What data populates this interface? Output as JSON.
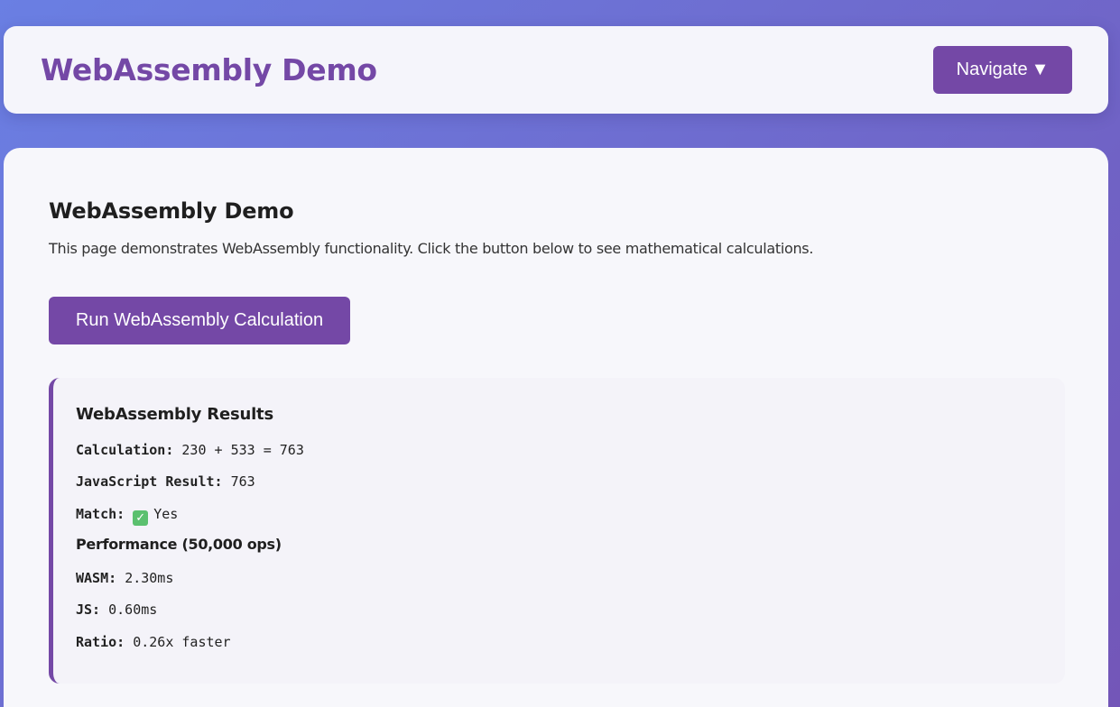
{
  "header": {
    "title": "WebAssembly Demo",
    "nav_label": "Navigate",
    "nav_caret": "▼"
  },
  "main": {
    "heading": "WebAssembly Demo",
    "description": "This page demonstrates WebAssembly functionality. Click the button below to see mathematical calculations.",
    "run_button_label": "Run WebAssembly Calculation"
  },
  "results": {
    "title": "WebAssembly Results",
    "calculation": {
      "label": "Calculation:",
      "value": "230 + 533 = 763"
    },
    "js_result": {
      "label": "JavaScript Result:",
      "value": "763"
    },
    "match": {
      "label": "Match:",
      "icon": "check-mark-icon",
      "value": "Yes"
    },
    "performance": {
      "title": "Performance (50,000 ops)",
      "wasm": {
        "label": "WASM:",
        "value": "2.30ms"
      },
      "js": {
        "label": "JS:",
        "value": "0.60ms"
      },
      "ratio": {
        "label": "Ratio:",
        "value": "0.26x faster"
      }
    }
  },
  "colors": {
    "accent": "#7448a6",
    "background_start": "#6a7fe3",
    "background_end": "#7356b8",
    "success": "#5bc06f"
  }
}
